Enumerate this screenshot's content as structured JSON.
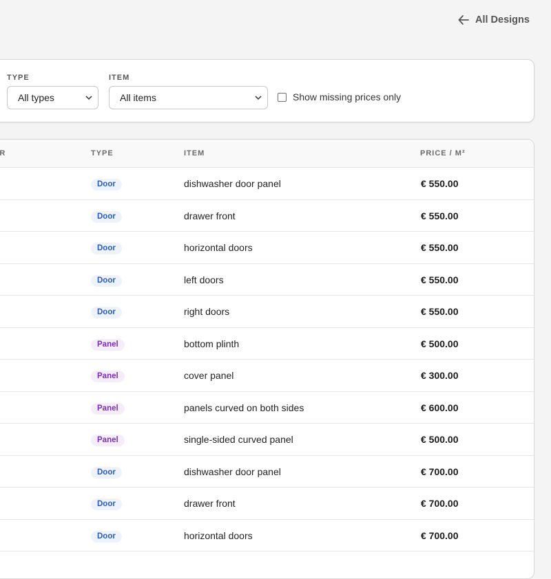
{
  "header": {
    "back_label": "All Designs",
    "back_icon": "arrow-left-icon"
  },
  "filters": {
    "type_label": "TYPE",
    "type_value": "All types",
    "item_label": "ITEM",
    "item_value": "All items",
    "missing_prices_label": "Show missing prices only",
    "missing_prices_checked": false
  },
  "table": {
    "headers": {
      "first_partial": "ER",
      "type": "TYPE",
      "item": "ITEM",
      "price": "PRICE / M²"
    },
    "rows": [
      {
        "type": "Door",
        "item": "dishwasher door panel",
        "price": "€ 550.00"
      },
      {
        "type": "Door",
        "item": "drawer front",
        "price": "€ 550.00"
      },
      {
        "type": "Door",
        "item": "horizontal doors",
        "price": "€ 550.00"
      },
      {
        "type": "Door",
        "item": "left doors",
        "price": "€ 550.00"
      },
      {
        "type": "Door",
        "item": "right doors",
        "price": "€ 550.00"
      },
      {
        "type": "Panel",
        "item": "bottom plinth",
        "price": "€ 500.00"
      },
      {
        "type": "Panel",
        "item": "cover panel",
        "price": "€ 300.00"
      },
      {
        "type": "Panel",
        "item": "panels curved on both sides",
        "price": "€ 600.00"
      },
      {
        "type": "Panel",
        "item": "single-sided curved panel",
        "price": "€ 500.00"
      },
      {
        "type": "Door",
        "item": "dishwasher door panel",
        "price": "€ 700.00"
      },
      {
        "type": "Door",
        "item": "drawer front",
        "price": "€ 700.00"
      },
      {
        "type": "Door",
        "item": "horizontal doors",
        "price": "€ 700.00"
      }
    ]
  },
  "colors": {
    "door_badge_text": "#2b5cb8",
    "door_badge_bg": "#eef3fb",
    "panel_badge_text": "#7a2fb8",
    "panel_badge_bg": "#f5eefa"
  }
}
